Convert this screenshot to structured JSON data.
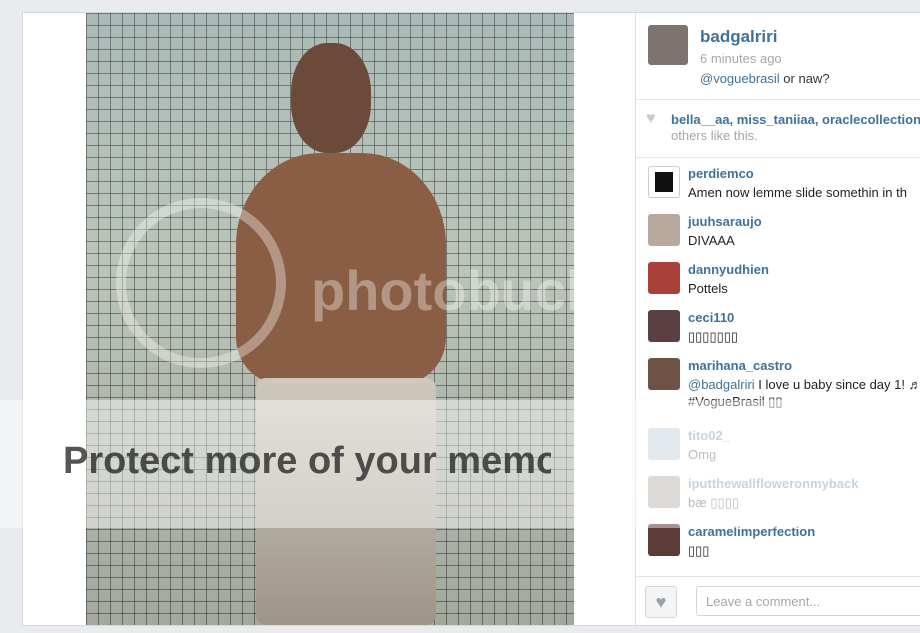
{
  "post": {
    "username": "badgalriri",
    "time_ago": "6 minutes ago",
    "caption_mention": "@voguebrasil",
    "caption_text": " or naw?"
  },
  "watermark": {
    "logo_text": "photobucket",
    "banner_text": "Protect more of your memories for less!"
  },
  "likes": {
    "names": "bella__aa, miss_taniiaa, oraclecollection",
    "tail": "others like this."
  },
  "comments": [
    {
      "user": "perdiemco",
      "text": "Amen now lemme slide somethin in th"
    },
    {
      "user": "juuhsaraujo",
      "text": "DIVAAA"
    },
    {
      "user": "dannyudhien",
      "text": "Pottels"
    },
    {
      "user": "ceci110",
      "text": "▯▯▯▯▯▯▯"
    },
    {
      "user": "marihana_castro",
      "mention": "@badgalriri",
      "text": " I love u baby since day 1! ♬",
      "text2": "#VogueBrasil ▯▯"
    },
    {
      "user": "tito02_",
      "text": "Omg"
    },
    {
      "user": "iputthewallfloweronmyback",
      "text": "bæ ▯▯▯▯"
    },
    {
      "user": "caramelimperfection",
      "text": "▯▯▯"
    }
  ],
  "footer": {
    "comment_placeholder": "Leave a comment..."
  },
  "colors": {
    "link": "#3f729b",
    "muted": "#a5a7aa",
    "border": "#e3e5e8"
  }
}
